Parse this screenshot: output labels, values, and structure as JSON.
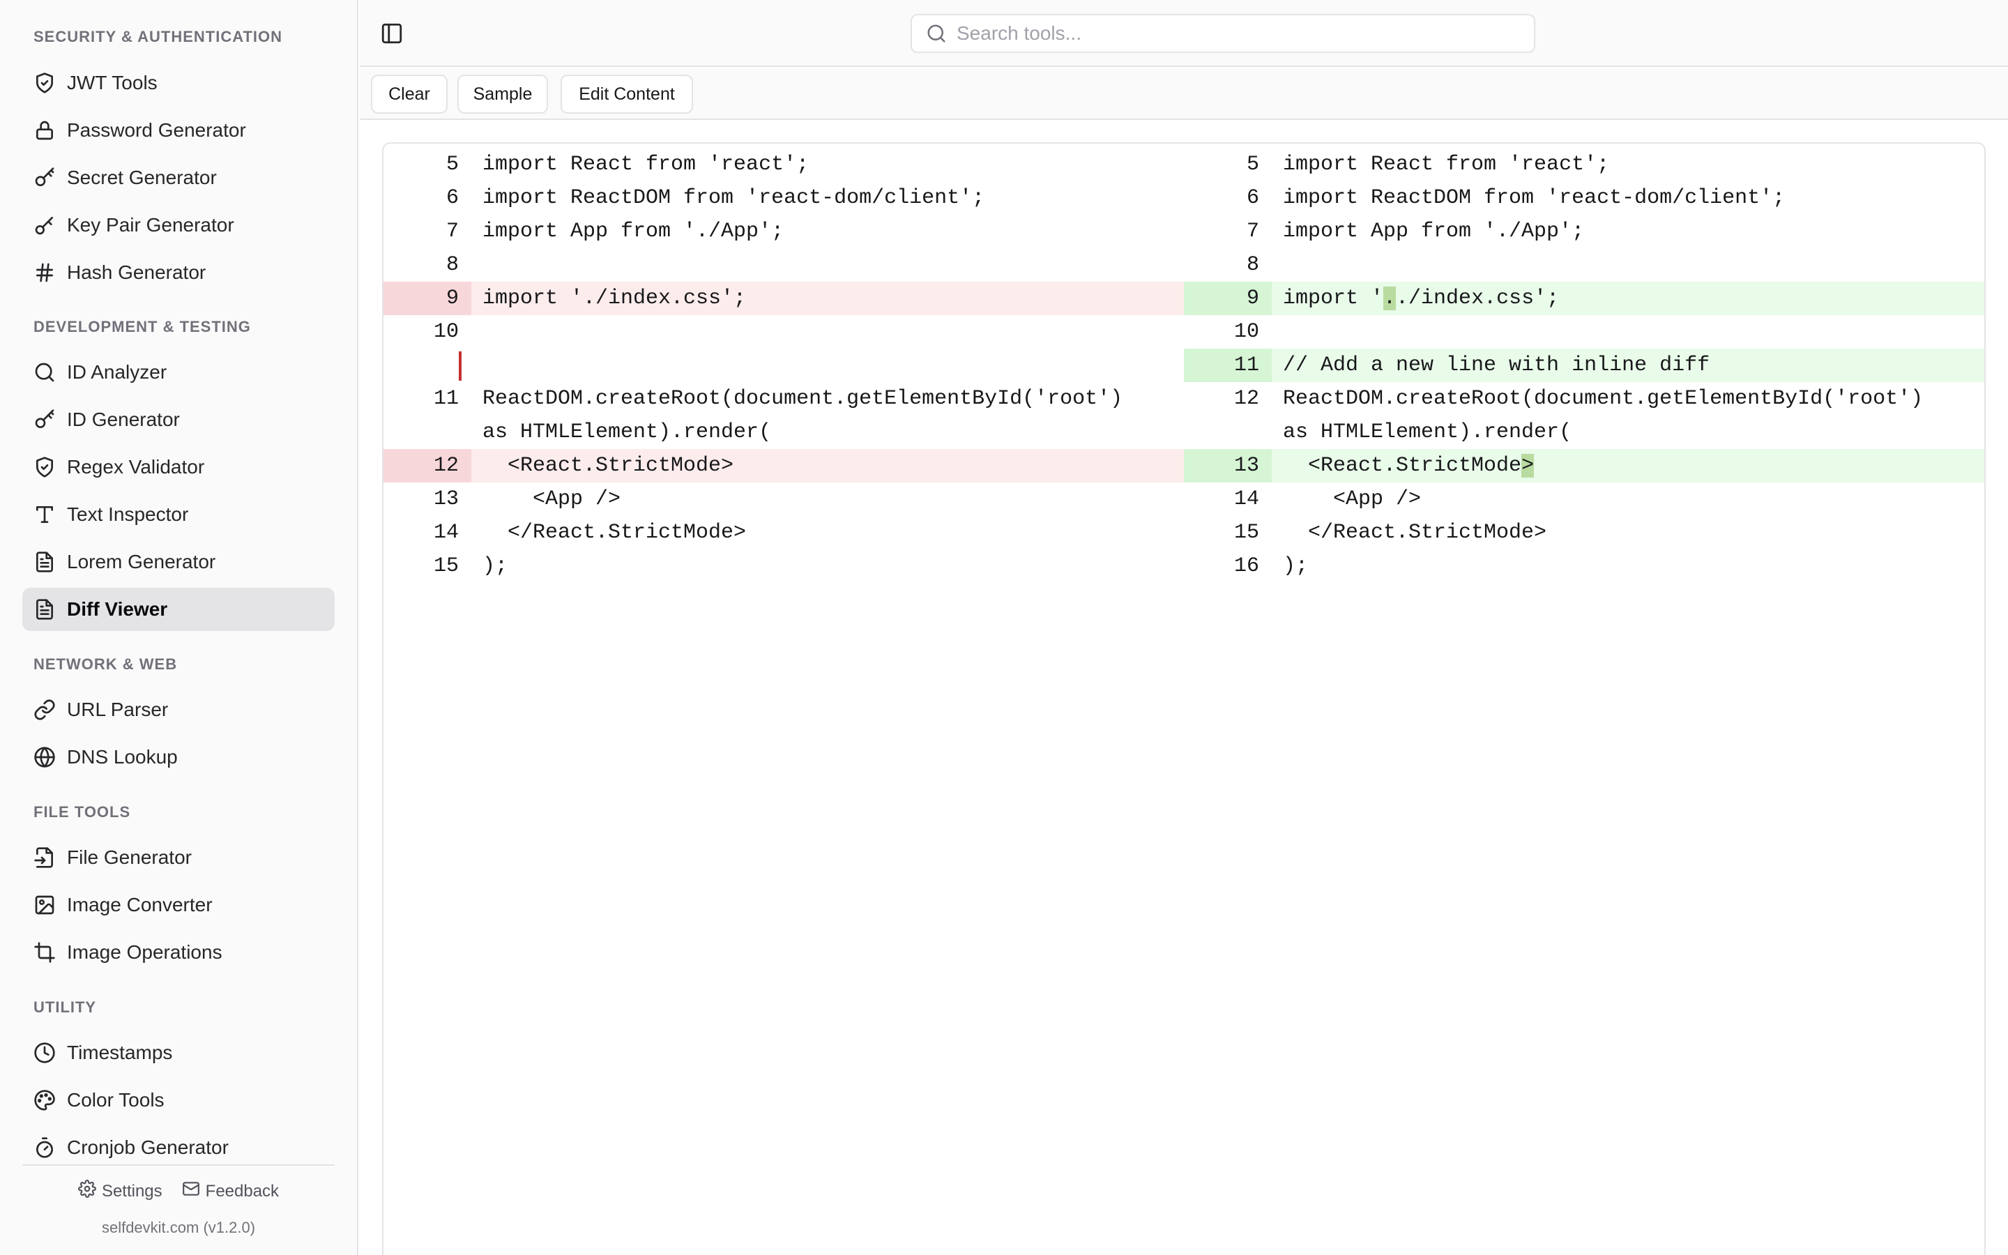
{
  "sidebar": {
    "sections": [
      {
        "title": "SECURITY & AUTHENTICATION",
        "items": [
          {
            "label": "JWT Tools",
            "icon": "shield-check-icon"
          },
          {
            "label": "Password Generator",
            "icon": "lock-icon"
          },
          {
            "label": "Secret Generator",
            "icon": "key-round-icon"
          },
          {
            "label": "Key Pair Generator",
            "icon": "key-icon"
          },
          {
            "label": "Hash Generator",
            "icon": "hash-icon"
          }
        ]
      },
      {
        "title": "DEVELOPMENT & TESTING",
        "items": [
          {
            "label": "ID Analyzer",
            "icon": "search-icon"
          },
          {
            "label": "ID Generator",
            "icon": "key-round-icon"
          },
          {
            "label": "Regex Validator",
            "icon": "shield-check-icon"
          },
          {
            "label": "Text Inspector",
            "icon": "type-icon"
          },
          {
            "label": "Lorem Generator",
            "icon": "file-text-icon"
          },
          {
            "label": "Diff Viewer",
            "icon": "file-text-icon",
            "active": true
          }
        ]
      },
      {
        "title": "NETWORK & WEB",
        "items": [
          {
            "label": "URL Parser",
            "icon": "link-icon"
          },
          {
            "label": "DNS Lookup",
            "icon": "globe-icon"
          }
        ]
      },
      {
        "title": "FILE TOOLS",
        "items": [
          {
            "label": "File Generator",
            "icon": "file-input-icon"
          },
          {
            "label": "Image Converter",
            "icon": "image-icon"
          },
          {
            "label": "Image Operations",
            "icon": "crop-icon"
          }
        ]
      },
      {
        "title": "UTILITY",
        "items": [
          {
            "label": "Timestamps",
            "icon": "clock-icon"
          },
          {
            "label": "Color Tools",
            "icon": "palette-icon"
          },
          {
            "label": "Cronjob Generator",
            "icon": "timer-icon"
          }
        ]
      }
    ],
    "footer": {
      "settings_label": "Settings",
      "feedback_label": "Feedback",
      "version": "selfdevkit.com (v1.2.0)"
    }
  },
  "header": {
    "search_placeholder": "Search tools..."
  },
  "toolbar": {
    "clear_label": "Clear",
    "sample_label": "Sample",
    "edit_label": "Edit Content"
  },
  "diff": {
    "left": [
      {
        "ln": "5",
        "code": "import React from 'react';"
      },
      {
        "ln": "6",
        "code": "import ReactDOM from 'react-dom/client';"
      },
      {
        "ln": "7",
        "code": "import App from './App';"
      },
      {
        "ln": "8",
        "code": ""
      },
      {
        "ln": "9",
        "code": "import './index.css';",
        "type": "del"
      },
      {
        "ln": "10",
        "code": ""
      },
      {
        "ln": "",
        "code": "",
        "cursor": true
      },
      {
        "ln": "11",
        "code": "ReactDOM.createRoot(document.getElementById('root')"
      },
      {
        "ln": "",
        "code": "as HTMLElement).render("
      },
      {
        "ln": "12",
        "code": "  <React.StrictMode>",
        "type": "del"
      },
      {
        "ln": "13",
        "code": "    <App />"
      },
      {
        "ln": "14",
        "code": "  </React.StrictMode>"
      },
      {
        "ln": "15",
        "code": ");"
      }
    ],
    "right": [
      {
        "ln": "5",
        "code": "import React from 'react';"
      },
      {
        "ln": "6",
        "code": "import ReactDOM from 'react-dom/client';"
      },
      {
        "ln": "7",
        "code": "import App from './App';"
      },
      {
        "ln": "8",
        "code": ""
      },
      {
        "ln": "9",
        "code": "import '../index.css';",
        "type": "add",
        "hl": [
          8,
          9
        ]
      },
      {
        "ln": "10",
        "code": ""
      },
      {
        "ln": "11",
        "code": "// Add a new line with inline diff",
        "type": "add"
      },
      {
        "ln": "12",
        "code": "ReactDOM.createRoot(document.getElementById('root')"
      },
      {
        "ln": "",
        "code": "as HTMLElement).render("
      },
      {
        "ln": "13",
        "code": "  <React.StrictMode> ",
        "type": "add",
        "hl": [
          19,
          20
        ]
      },
      {
        "ln": "14",
        "code": "    <App />"
      },
      {
        "ln": "15",
        "code": "  </React.StrictMode>"
      },
      {
        "ln": "16",
        "code": ");"
      }
    ]
  }
}
